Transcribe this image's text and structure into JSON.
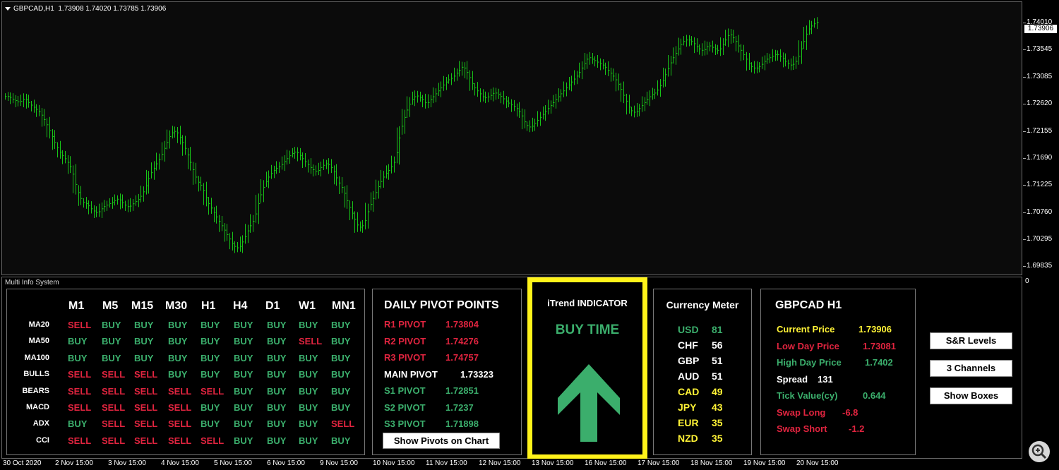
{
  "chart": {
    "symbol": "GBPCAD,H1",
    "ohlc": "1.73908 1.74020 1.73785 1.73906",
    "current_price": "1.73906",
    "price_levels": [
      "1.74010",
      "1.73545",
      "1.73085",
      "1.72620",
      "1.72155",
      "1.71690",
      "1.71225",
      "1.70760",
      "1.70295",
      "1.69835"
    ],
    "time_labels": [
      "30 Oct 2020",
      "2 Nov 15:00",
      "3 Nov 15:00",
      "4 Nov 15:00",
      "5 Nov 15:00",
      "6 Nov 15:00",
      "9 Nov 15:00",
      "10 Nov 15:00",
      "11 Nov 15:00",
      "12 Nov 15:00",
      "13 Nov 15:00",
      "16 Nov 15:00",
      "17 Nov 15:00",
      "18 Nov 15:00",
      "19 Nov 15:00",
      "20 Nov 15:00"
    ],
    "bar_color": "#18c418",
    "ylim": [
      1.6966,
      1.7428
    ],
    "closes": [
      1.7268,
      1.7262,
      1.7258,
      1.7265,
      1.7255,
      1.7248,
      1.724,
      1.7225,
      1.7205,
      1.7185,
      1.717,
      1.716,
      1.7145,
      1.711,
      1.709,
      1.7085,
      1.7075,
      1.707,
      1.708,
      1.7085,
      1.709,
      1.7095,
      1.7085,
      1.708,
      1.7088,
      1.7095,
      1.711,
      1.7135,
      1.715,
      1.7165,
      1.7185,
      1.7205,
      1.721,
      1.7195,
      1.7175,
      1.715,
      1.7125,
      1.7115,
      1.709,
      1.7075,
      1.706,
      1.7045,
      1.703,
      1.7015,
      1.701,
      1.7025,
      1.7045,
      1.706,
      1.7095,
      1.712,
      1.7135,
      1.7145,
      1.715,
      1.716,
      1.717,
      1.7175,
      1.7165,
      1.7155,
      1.7145,
      1.714,
      1.715,
      1.7155,
      1.7145,
      1.7125,
      1.711,
      1.7085,
      1.7065,
      1.7045,
      1.705,
      1.708,
      1.71,
      1.712,
      1.7135,
      1.7145,
      1.716,
      1.721,
      1.724,
      1.726,
      1.727,
      1.7265,
      1.7255,
      1.7265,
      1.7275,
      1.7285,
      1.7295,
      1.73,
      1.731,
      1.732,
      1.7305,
      1.7285,
      1.7275,
      1.7265,
      1.7268,
      1.7275,
      1.727,
      1.7262,
      1.7255,
      1.725,
      1.724,
      1.722,
      1.7215,
      1.7225,
      1.7235,
      1.7245,
      1.7255,
      1.7265,
      1.7275,
      1.7285,
      1.7295,
      1.7305,
      1.732,
      1.7335,
      1.733,
      1.7325,
      1.732,
      1.731,
      1.73,
      1.7285,
      1.7265,
      1.7245,
      1.724,
      1.725,
      1.726,
      1.727,
      1.7275,
      1.729,
      1.731,
      1.733,
      1.7345,
      1.736,
      1.7365,
      1.736,
      1.735,
      1.7345,
      1.7355,
      1.735,
      1.7345,
      1.736,
      1.7375,
      1.7365,
      1.735,
      1.7335,
      1.732,
      1.7315,
      1.732,
      1.733,
      1.7335,
      1.734,
      1.7335,
      1.7325,
      1.732,
      1.733,
      1.7355,
      1.738,
      1.739,
      1.7395
    ]
  },
  "subwindow": {
    "title": "Multi Info System",
    "scale_label": "0"
  },
  "timeframe_table": {
    "headers": [
      "M1",
      "M5",
      "M15",
      "M30",
      "H1",
      "H4",
      "D1",
      "W1",
      "MN1"
    ],
    "rows": [
      {
        "label": "MA20",
        "signals": [
          "SELL",
          "BUY",
          "BUY",
          "BUY",
          "BUY",
          "BUY",
          "BUY",
          "BUY",
          "BUY"
        ]
      },
      {
        "label": "MA50",
        "signals": [
          "BUY",
          "BUY",
          "BUY",
          "BUY",
          "BUY",
          "BUY",
          "BUY",
          "SELL",
          "BUY"
        ]
      },
      {
        "label": "MA100",
        "signals": [
          "BUY",
          "BUY",
          "BUY",
          "BUY",
          "BUY",
          "BUY",
          "BUY",
          "BUY",
          "BUY"
        ]
      },
      {
        "label": "BULLS",
        "signals": [
          "SELL",
          "SELL",
          "SELL",
          "BUY",
          "BUY",
          "BUY",
          "BUY",
          "BUY",
          "BUY"
        ]
      },
      {
        "label": "BEARS",
        "signals": [
          "SELL",
          "SELL",
          "SELL",
          "SELL",
          "SELL",
          "BUY",
          "BUY",
          "BUY",
          "BUY"
        ]
      },
      {
        "label": "MACD",
        "signals": [
          "SELL",
          "SELL",
          "SELL",
          "SELL",
          "BUY",
          "BUY",
          "BUY",
          "BUY",
          "BUY"
        ]
      },
      {
        "label": "ADX",
        "signals": [
          "BUY",
          "SELL",
          "SELL",
          "SELL",
          "BUY",
          "BUY",
          "BUY",
          "BUY",
          "SELL"
        ]
      },
      {
        "label": "CCI",
        "signals": [
          "SELL",
          "SELL",
          "SELL",
          "SELL",
          "SELL",
          "BUY",
          "BUY",
          "BUY",
          "BUY"
        ]
      }
    ]
  },
  "pivots": {
    "title": "DAILY PIVOT POINTS",
    "rows": [
      {
        "label": "R1 PIVOT",
        "value": "1.73804",
        "color": "r"
      },
      {
        "label": "R2 PIVOT",
        "value": "1.74276",
        "color": "r"
      },
      {
        "label": "R3 PIVOT",
        "value": "1.74757",
        "color": "r"
      },
      {
        "label": "MAIN PIVOT",
        "value": "1.73323",
        "color": "w"
      },
      {
        "label": "S1 PIVOT",
        "value": "1.72851",
        "color": "g"
      },
      {
        "label": "S2 PIVOT",
        "value": "1.7237",
        "color": "g"
      },
      {
        "label": "S3 PIVOT",
        "value": "1.71898",
        "color": "g"
      }
    ],
    "button": "Show Pivots on Chart"
  },
  "itrend": {
    "title": "iTrend INDICATOR",
    "signal": "BUY TIME",
    "arrow_color": "#3bae6c",
    "border_color": "#fff31a"
  },
  "currency_meter": {
    "title": "Currency Meter",
    "rows": [
      {
        "cur": "USD",
        "val": "81",
        "color": "g"
      },
      {
        "cur": "CHF",
        "val": "56",
        "color": "w"
      },
      {
        "cur": "GBP",
        "val": "51",
        "color": "w"
      },
      {
        "cur": "AUD",
        "val": "51",
        "color": "w"
      },
      {
        "cur": "CAD",
        "val": "49",
        "color": "y"
      },
      {
        "cur": "JPY",
        "val": "43",
        "color": "y"
      },
      {
        "cur": "EUR",
        "val": "35",
        "color": "y"
      },
      {
        "cur": "NZD",
        "val": "35",
        "color": "y"
      }
    ]
  },
  "symbol_info": {
    "title": "GBPCAD H1",
    "rows": [
      {
        "label": "Current Price",
        "value": "1.73906",
        "color": "y"
      },
      {
        "label": "Low Day Price",
        "value": "1.73081",
        "color": "r"
      },
      {
        "label": "High Day Price",
        "value": "1.7402",
        "color": "g"
      },
      {
        "label": "Spread",
        "value": "131",
        "color": "w"
      },
      {
        "label": "Tick Value(cy)",
        "value": "0.644",
        "color": "g"
      },
      {
        "label": "Swap Long",
        "value": "-6.8",
        "color": "r"
      },
      {
        "label": "Swap Short",
        "value": "-1.2",
        "color": "r"
      }
    ]
  },
  "buttons": {
    "sr_levels": "S&R Levels",
    "channels": "3 Channels",
    "show_boxes": "Show Boxes"
  }
}
